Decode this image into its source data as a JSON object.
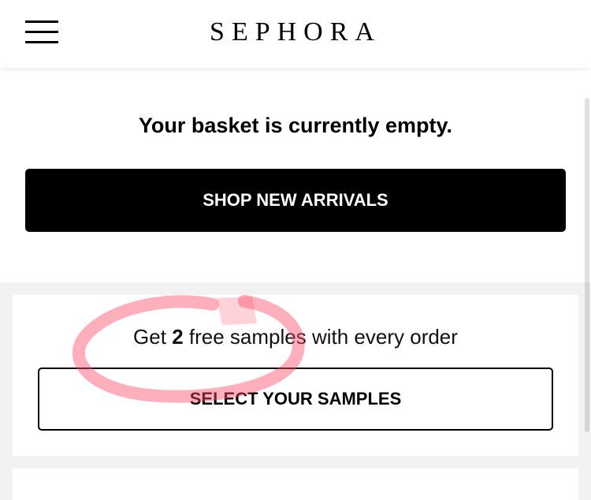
{
  "header": {
    "logo_text": "SEPHORA",
    "menu_icon": "hamburger-menu-icon"
  },
  "basket": {
    "empty_message": "Your basket is currently empty.",
    "shop_button_label": "SHOP NEW ARRIVALS"
  },
  "samples": {
    "text_prefix": "Get",
    "count": "2",
    "text_suffix": "free samples with every order",
    "button_label": "SELECT YOUR SAMPLES"
  },
  "colors": {
    "primary": "#000000",
    "page_background": "#f2f2f2",
    "annotation": "#ff4d6a"
  }
}
